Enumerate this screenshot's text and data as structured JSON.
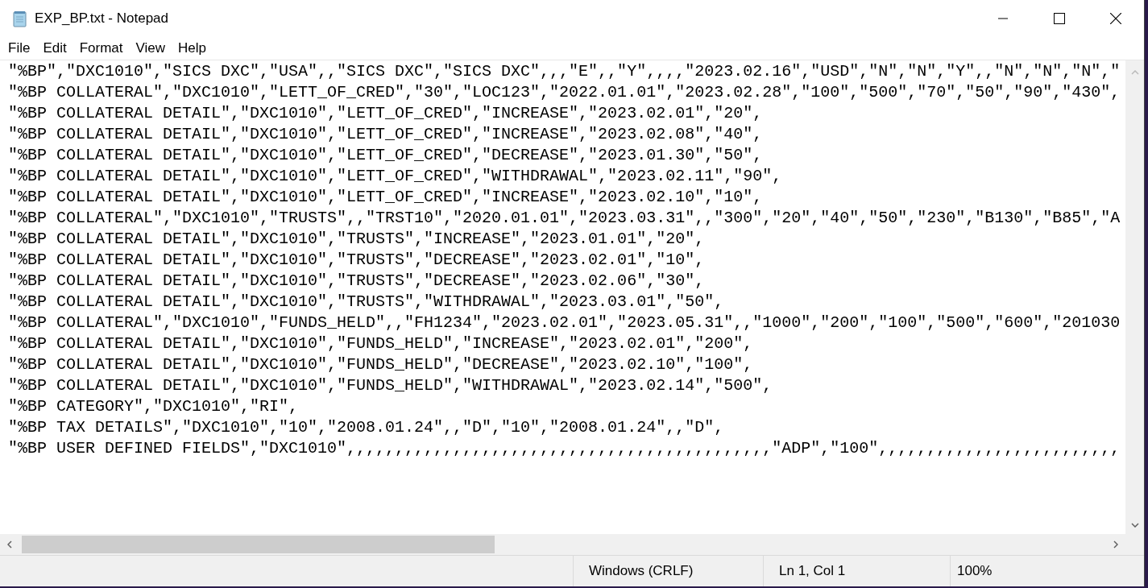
{
  "window": {
    "title": "EXP_BP.txt - Notepad"
  },
  "menu": [
    "File",
    "Edit",
    "Format",
    "View",
    "Help"
  ],
  "lines": [
    "\"%BP\",\"DXC1010\",\"SICS DXC\",\"USA\",,\"SICS DXC\",\"SICS DXC\",,,\"E\",,\"Y\",,,,\"2023.02.16\",\"USD\",\"N\",\"N\",\"Y\",,\"N\",\"N\",\"N\",\"",
    "\"%BP COLLATERAL\",\"DXC1010\",\"LETT_OF_CRED\",\"30\",\"LOC123\",\"2022.01.01\",\"2023.02.28\",\"100\",\"500\",\"70\",\"50\",\"90\",\"430\",",
    "\"%BP COLLATERAL DETAIL\",\"DXC1010\",\"LETT_OF_CRED\",\"INCREASE\",\"2023.02.01\",\"20\",",
    "\"%BP COLLATERAL DETAIL\",\"DXC1010\",\"LETT_OF_CRED\",\"INCREASE\",\"2023.02.08\",\"40\",",
    "\"%BP COLLATERAL DETAIL\",\"DXC1010\",\"LETT_OF_CRED\",\"DECREASE\",\"2023.01.30\",\"50\",",
    "\"%BP COLLATERAL DETAIL\",\"DXC1010\",\"LETT_OF_CRED\",\"WITHDRAWAL\",\"2023.02.11\",\"90\",",
    "\"%BP COLLATERAL DETAIL\",\"DXC1010\",\"LETT_OF_CRED\",\"INCREASE\",\"2023.02.10\",\"10\",",
    "\"%BP COLLATERAL\",\"DXC1010\",\"TRUSTS\",,\"TRST10\",\"2020.01.01\",\"2023.03.31\",,\"300\",\"20\",\"40\",\"50\",\"230\",\"B130\",\"B85\",\"A",
    "\"%BP COLLATERAL DETAIL\",\"DXC1010\",\"TRUSTS\",\"INCREASE\",\"2023.01.01\",\"20\",",
    "\"%BP COLLATERAL DETAIL\",\"DXC1010\",\"TRUSTS\",\"DECREASE\",\"2023.02.01\",\"10\",",
    "\"%BP COLLATERAL DETAIL\",\"DXC1010\",\"TRUSTS\",\"DECREASE\",\"2023.02.06\",\"30\",",
    "\"%BP COLLATERAL DETAIL\",\"DXC1010\",\"TRUSTS\",\"WITHDRAWAL\",\"2023.03.01\",\"50\",",
    "\"%BP COLLATERAL\",\"DXC1010\",\"FUNDS_HELD\",,\"FH1234\",\"2023.02.01\",\"2023.05.31\",,\"1000\",\"200\",\"100\",\"500\",\"600\",\"201030",
    "\"%BP COLLATERAL DETAIL\",\"DXC1010\",\"FUNDS_HELD\",\"INCREASE\",\"2023.02.01\",\"200\",",
    "\"%BP COLLATERAL DETAIL\",\"DXC1010\",\"FUNDS_HELD\",\"DECREASE\",\"2023.02.10\",\"100\",",
    "\"%BP COLLATERAL DETAIL\",\"DXC1010\",\"FUNDS_HELD\",\"WITHDRAWAL\",\"2023.02.14\",\"500\",",
    "\"%BP CATEGORY\",\"DXC1010\",\"RI\",",
    "\"%BP TAX DETAILS\",\"DXC1010\",\"10\",\"2008.01.24\",,\"D\",\"10\",\"2008.01.24\",,\"D\",",
    "\"%BP USER DEFINED FIELDS\",\"DXC1010\",,,,,,,,,,,,,,,,,,,,,,,,,,,,,,,,,,,,,,,,,,,,\"ADP\",\"100\",,,,,,,,,,,,,,,,,,,,,,,,,"
  ],
  "status_bar": [
    "Windows (CRLF)",
    "Ln 1, Col 1",
    "100%"
  ]
}
